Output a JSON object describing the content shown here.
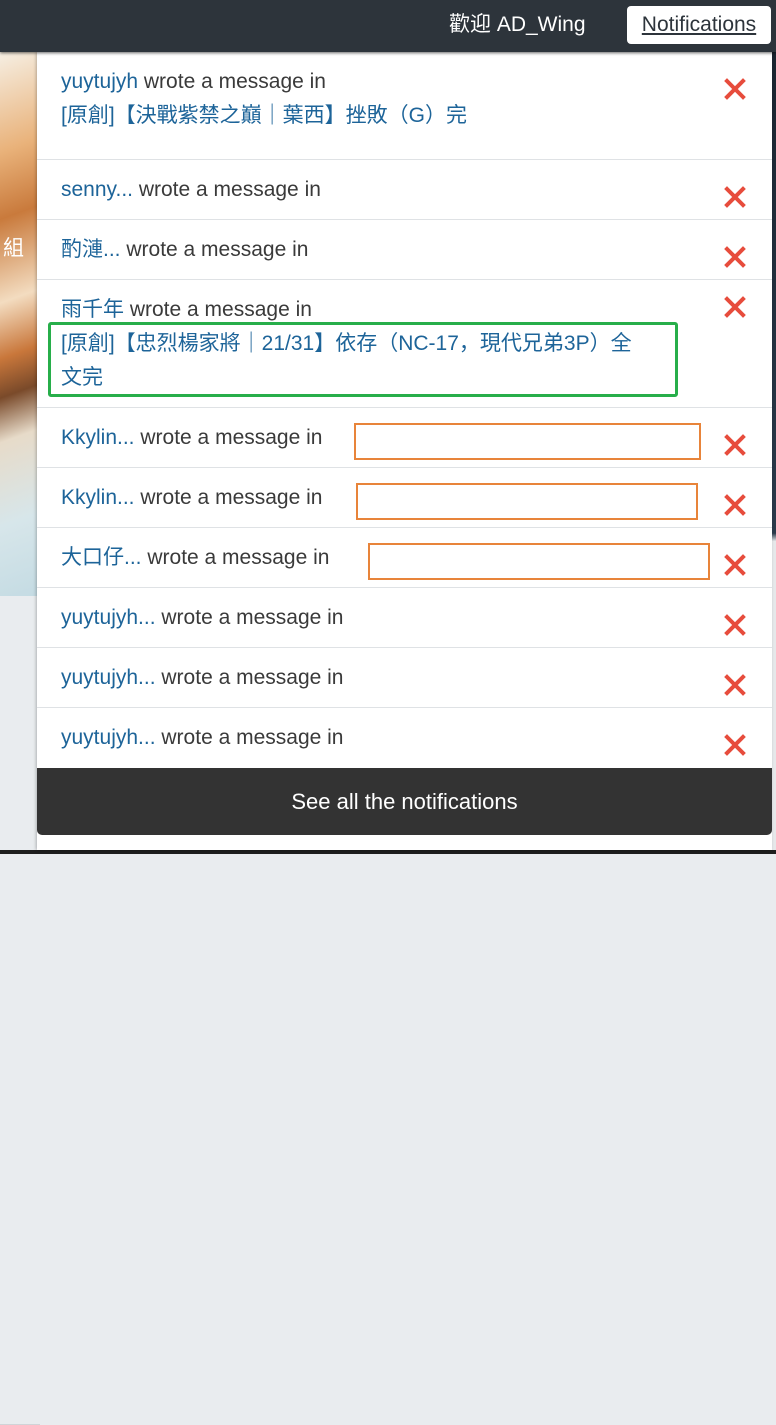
{
  "header": {
    "welcome_text": "歡迎 AD_Wing",
    "notifications_button": "Notifications"
  },
  "background": {
    "hero_text_fragment": "組"
  },
  "notifications": {
    "items": [
      {
        "user": "yuytujyh",
        "verb": "wrote a message in",
        "title": "[原創]【決戰紫禁之巔｜葉西】挫敗（G）完"
      },
      {
        "user": "senny...",
        "verb": "wrote a message in",
        "title": ""
      },
      {
        "user": "酌漣...",
        "verb": "wrote a message in",
        "title": ""
      },
      {
        "user": "雨千年",
        "verb": "wrote a message in",
        "title": "[原創]【忠烈楊家將｜21/31】依存（NC-17，現代兄弟3P）全文完"
      },
      {
        "user": "Kkylin...",
        "verb": "wrote a message in",
        "title": ""
      },
      {
        "user": "Kkylin...",
        "verb": "wrote a message in",
        "title": ""
      },
      {
        "user": "大口仔...",
        "verb": "wrote a message in",
        "title": ""
      },
      {
        "user": "yuytujyh...",
        "verb": "wrote a message in",
        "title": ""
      },
      {
        "user": "yuytujyh...",
        "verb": "wrote a message in",
        "title": ""
      },
      {
        "user": "yuytujyh...",
        "verb": "wrote a message in",
        "title": ""
      }
    ],
    "close_icon": "close-icon",
    "see_all_label": "See all the notifications"
  },
  "colors": {
    "topbar": "#2d343b",
    "link": "#1d6499",
    "close": "#e74c3c",
    "highlight_green": "#27ae4a",
    "highlight_orange": "#e8843a",
    "footer": "#333333"
  }
}
